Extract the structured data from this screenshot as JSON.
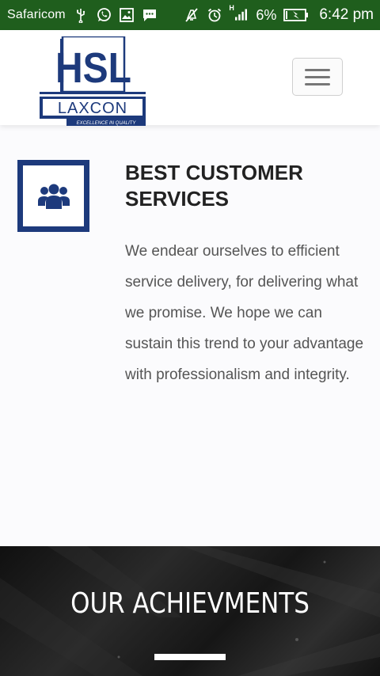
{
  "status_bar": {
    "carrier": "Safaricom",
    "battery_percent": "6%",
    "time": "6:42 pm",
    "network_label": "H",
    "icons": [
      "usb-icon",
      "whatsapp-icon",
      "gallery-icon",
      "message-icon",
      "mute-icon",
      "alarm-icon",
      "signal-icon",
      "battery-charging-icon"
    ]
  },
  "header": {
    "logo": {
      "top_text": "HSL",
      "bottom_text": "LAXCON",
      "tagline": "EXCELLENCE IN QUALITY"
    },
    "menu_icon": "hamburger-icon"
  },
  "feature": {
    "icon": "users-icon",
    "title": "BEST CUSTOMER SERVICES",
    "text": "We endear ourselves to efficient service delivery, for delivering what we promise. We hope we can sustain this trend to your advantage with professionalism and integrity."
  },
  "achievements": {
    "title": "OUR ACHIEVMENTS"
  },
  "colors": {
    "status_bar": "#1f5e1d",
    "brand_blue": "#1d3a7c",
    "heading": "#222222",
    "body_text": "#555555",
    "banner_bg": "#1a1a1a"
  }
}
